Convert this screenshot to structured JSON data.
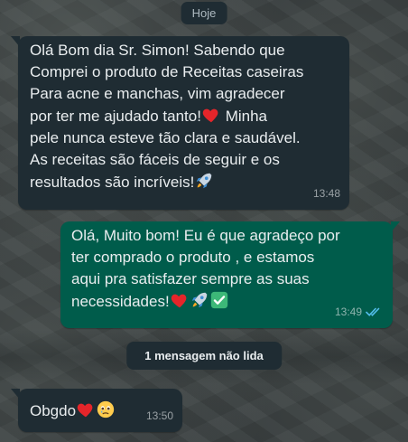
{
  "date_label": "Hoje",
  "messages": [
    {
      "direction": "incoming",
      "lines": [
        "Olá Bom dia Sr. Simon! Sabendo que",
        "Comprei o produto de Receitas caseiras",
        "Para acne e manchas, vim agradecer",
        "por ter me ajudado tanto!",
        "pele nunca esteve tão clara e saudável.",
        "As receitas são fáceis de seguir e os",
        "resultados são incríveis!"
      ],
      "line4_suffix": " Minha",
      "time": "13:48"
    },
    {
      "direction": "outgoing",
      "lines": [
        "Olá, Muito bom! Eu é que agradeço por",
        "ter comprado o produto , e estamos",
        "aqui pra satisfazer sempre as suas",
        "necessidades!"
      ],
      "time": "13:49",
      "status": "read"
    },
    {
      "direction": "incoming",
      "lines": [
        "Obgdo"
      ],
      "time": "13:50"
    }
  ],
  "unread_label": "1 mensagem não lida",
  "icons": {
    "heart": "red-heart-emoji",
    "rocket": "rocket-emoji",
    "check": "check-mark-emoji",
    "teary": "teary-face-emoji",
    "ticks": "double-check-icon"
  },
  "colors": {
    "incoming_bubble": "#1f2c33",
    "outgoing_bubble": "#005c4b",
    "read_ticks": "#53bdeb"
  }
}
